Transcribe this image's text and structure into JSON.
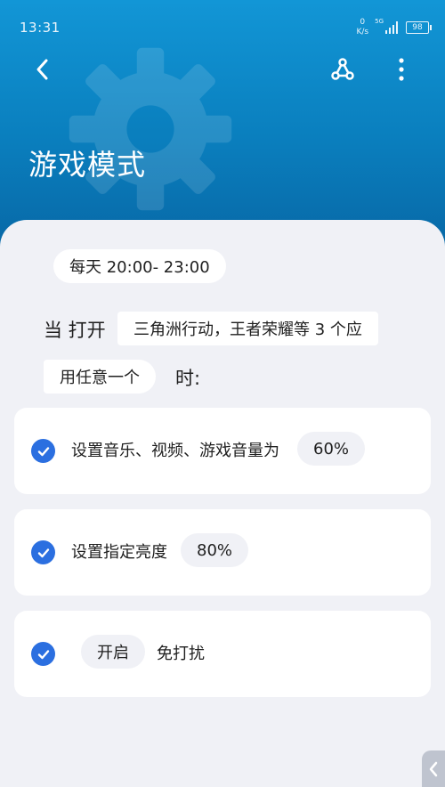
{
  "status_bar": {
    "time": "13:31",
    "net_speed_value": "0",
    "net_speed_unit": "K/s",
    "signal_label": "5G",
    "battery": "98"
  },
  "header": {
    "title": "游戏模式",
    "back_icon": "chevron-left-icon",
    "share_icon": "share-node-icon",
    "more_icon": "more-vertical-icon",
    "background_color": "#0a7fbe"
  },
  "trigger": {
    "time_range": "每天 20:00- 23:00",
    "when_open_prefix": "当 打开",
    "apps": "三角洲行动，王者荣耀等 3 个应",
    "any_condition": "用任意一个",
    "suffix": "时:"
  },
  "actions": [
    {
      "label": "设置音乐、视频、游戏音量为",
      "value": "60%",
      "checked": true
    },
    {
      "label": "设置指定亮度",
      "value": "80%",
      "checked": true
    },
    {
      "value": "开启",
      "label": "免打扰",
      "checked": true
    }
  ],
  "accent_color": "#2b6fe0"
}
